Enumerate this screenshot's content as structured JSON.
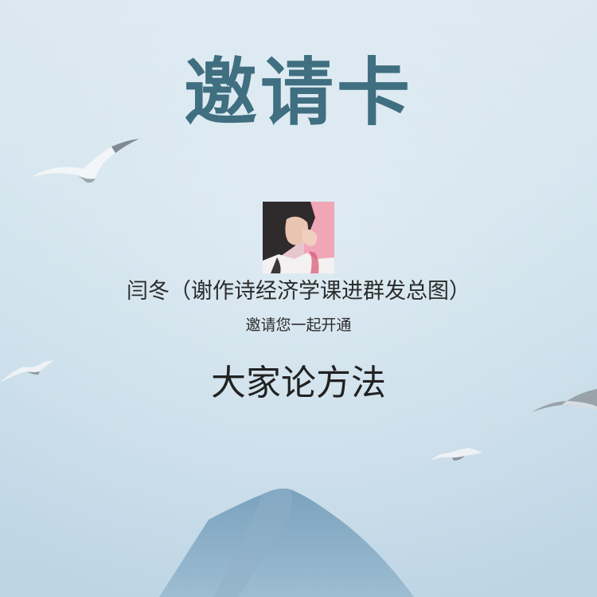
{
  "card": {
    "title": "邀请卡",
    "inviter_line": "闫冬（谢作诗经济学课进群发总图）",
    "subtitle": "邀请您一起开通",
    "group_name": "大家论方法"
  },
  "icons": {
    "avatar": "user-photo",
    "birds": "seagull-icon",
    "mountain": "mountain-illustration"
  },
  "colors": {
    "title": "#3f6f80",
    "text": "#2b2b2b",
    "sky_top": "#dbe8f1",
    "sky_bottom": "#bcd4e4",
    "mountain": "#6f98b6"
  }
}
